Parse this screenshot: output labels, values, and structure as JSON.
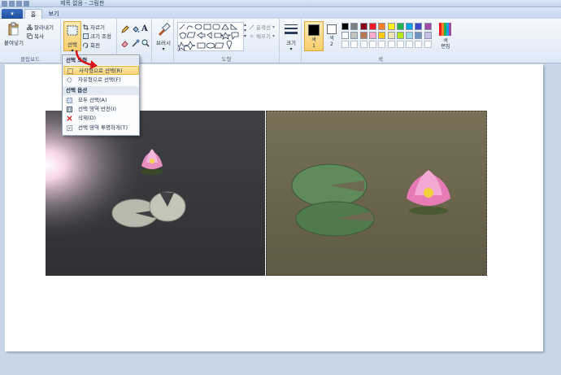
{
  "titlebar": {
    "title": "제목 없음 - 그림판"
  },
  "tabs": {
    "file": "▾",
    "home": "홈",
    "view": "보기"
  },
  "clipboard": {
    "paste": "붙여넣기",
    "cut": "잘라내기",
    "copy": "복사",
    "group": "클립보드"
  },
  "image": {
    "select": "선택",
    "crop": "자르기",
    "resize": "크기 조정",
    "rotate": "회전"
  },
  "tools": {
    "brush": "브러시",
    "shapes_group": "도형",
    "outline": "윤곽선",
    "fill": "채우기",
    "size": "크기"
  },
  "colors": {
    "color1_label": "색\n1",
    "color2_label": "색\n2",
    "edit": "색\n편집",
    "group": "색",
    "color1": "#000000",
    "color2": "#ffffff",
    "palette": [
      "#000000",
      "#7f7f7f",
      "#880015",
      "#ed1c24",
      "#ff7f27",
      "#fff200",
      "#22b14c",
      "#00a2e8",
      "#3f48cc",
      "#a349a4",
      "#ffffff",
      "#c3c3c3",
      "#b97a57",
      "#ffaec9",
      "#ffc90e",
      "#efe4b0",
      "#b5e61d",
      "#99d9ea",
      "#7092be",
      "#c8bfe7"
    ]
  },
  "menu": {
    "header1": "선택 도형",
    "rect_select": "사각형으로 선택(R)",
    "free_select": "자유형으로 선택(F)",
    "header2": "선택 옵션",
    "select_all": "모두 선택(A)",
    "invert": "선택 영역 반전(I)",
    "delete": "삭제(D)",
    "transparent": "선택 영역 투명하게(T)"
  }
}
